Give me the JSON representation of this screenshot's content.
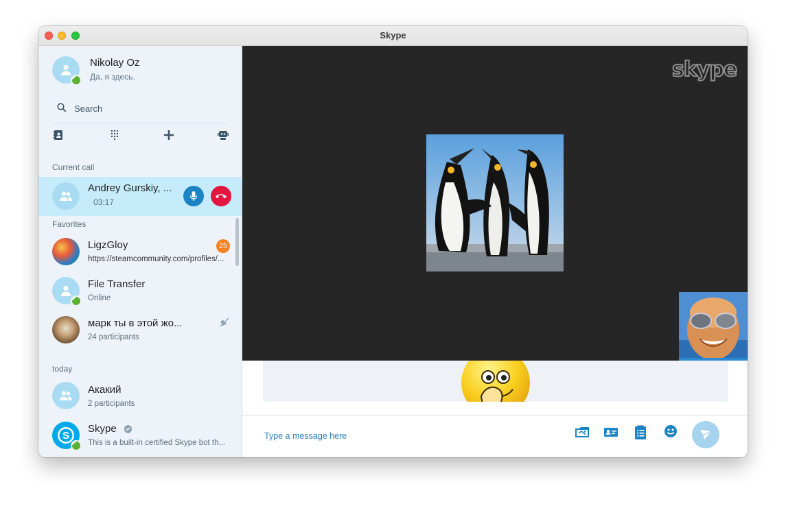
{
  "window": {
    "title": "Skype"
  },
  "profile": {
    "name": "Nikolay Oz",
    "status": "Да, я здесь."
  },
  "search": {
    "placeholder": "Search"
  },
  "toolbar": {
    "icons": [
      "contacts-icon",
      "dialpad-icon",
      "plus-icon",
      "bot-icon"
    ]
  },
  "current_call": {
    "section_label": "Current call",
    "name": "Andrey Gurskiy, ...",
    "duration": "03:17"
  },
  "favorites": {
    "section_label": "Favorites",
    "items": [
      {
        "name": "LigzGloy",
        "subtitle": "https://steamcommunity.com/profiles/...",
        "badge": "25"
      },
      {
        "name": "File Transfer",
        "subtitle": "Online"
      },
      {
        "name": "марк ты в этой жо...",
        "subtitle": "24 participants"
      }
    ]
  },
  "today": {
    "section_label": "today",
    "items": [
      {
        "name": "Акакий",
        "subtitle": "2 participants"
      },
      {
        "name": "Skype",
        "subtitle": "This is a built-in certified Skype bot th..."
      }
    ]
  },
  "video": {
    "logo_text": "skype"
  },
  "compose": {
    "placeholder": "Type a message here"
  },
  "colors": {
    "accent": "#1b84c4",
    "call_highlight": "#c6ebfb",
    "hangup": "#e3173d",
    "online": "#5bb230",
    "badge": "#f58220"
  }
}
